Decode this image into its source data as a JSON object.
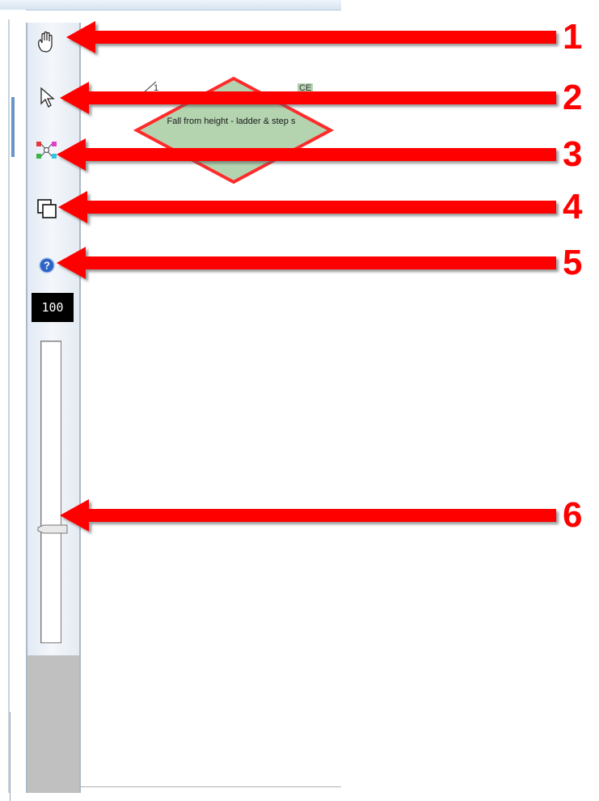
{
  "zoom": {
    "value": "100",
    "slider_level_percent": 62
  },
  "diagram_node": {
    "shape": "diamond",
    "label": "Fall from height - ladder & step s",
    "id_label": "1",
    "tag_label": "CE"
  },
  "toolbar": {
    "tools": [
      {
        "icon": "hand-pan-icon"
      },
      {
        "icon": "pointer-select-icon"
      },
      {
        "icon": "connector-icon"
      },
      {
        "icon": "copy-overlap-icon"
      },
      {
        "icon": "help-icon"
      }
    ]
  },
  "callouts": [
    "1",
    "2",
    "3",
    "4",
    "5",
    "6"
  ],
  "colors": {
    "arrow": "#ff0000",
    "node_fill": "#b4d4b0",
    "node_border": "#ff2020",
    "zoom_box": "#000000"
  }
}
